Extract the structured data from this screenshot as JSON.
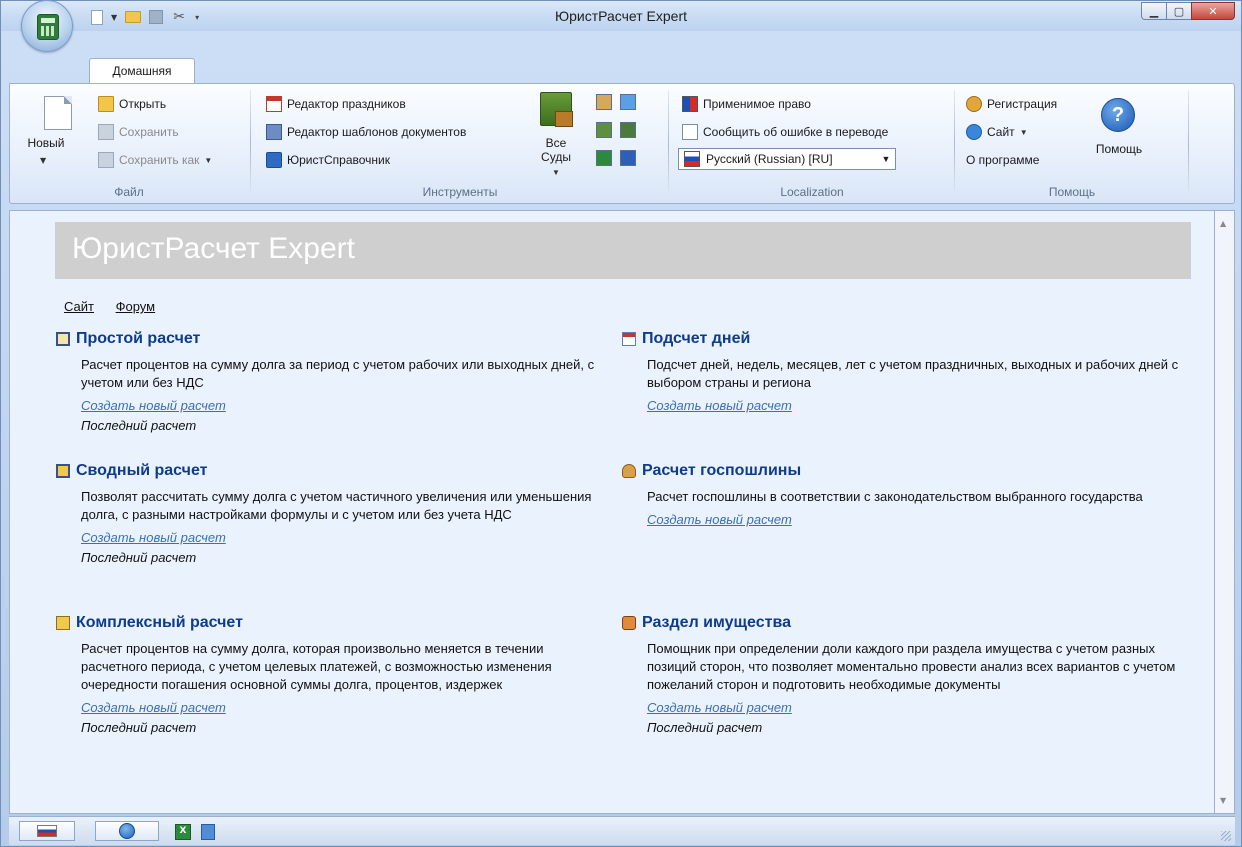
{
  "window": {
    "title": "ЮристРасчет Expert",
    "minimize_symbol": "▁",
    "maximize_symbol": "▢",
    "close_symbol": "✕"
  },
  "tabs": {
    "home": "Домашняя"
  },
  "ribbon": {
    "file": {
      "label": "Файл",
      "new": "Новый",
      "open": "Открыть",
      "save": "Сохранить",
      "save_as": "Сохранить как"
    },
    "tools": {
      "label": "Инструменты",
      "holidays_editor": "Редактор праздников",
      "templates_editor": "Редактор шаблонов документов",
      "reference": "ЮристСправочник",
      "all_courts_line1": "Все",
      "all_courts_line2": "Суды"
    },
    "localization": {
      "label": "Localization",
      "applicable_law": "Применимое право",
      "report_error": "Сообщить об ошибке в переводе",
      "language_selected": "Русский (Russian) [RU]"
    },
    "help": {
      "label": "Помощь",
      "registration": "Регистрация",
      "site": "Сайт",
      "about": "О программе",
      "help_button": "Помощь",
      "help_symbol": "?"
    }
  },
  "content": {
    "banner_title": "ЮристРасчет Expert",
    "links": {
      "site": "Сайт",
      "forum": "Форум"
    },
    "sections": [
      {
        "title": "Простой расчет",
        "description": "Расчет процентов на сумму долга за период с учетом рабочих или выходных дней, с учетом или без НДС",
        "create_link": "Создать новый расчет",
        "last_label": "Последний расчет"
      },
      {
        "title": "Подсчет дней",
        "description": "Подсчет дней, недель, месяцев, лет с учетом праздничных, выходных и рабочих дней с выбором страны и региона",
        "create_link": "Создать новый расчет"
      },
      {
        "title": "Сводный расчет",
        "description": "Позволят рассчитать сумму долга с учетом частичного увеличения или уменьшения долга, с разными настройками формулы и с учетом или без учета НДС",
        "create_link": "Создать новый расчет",
        "last_label": "Последний расчет"
      },
      {
        "title": "Расчет госпошлины",
        "description": "Расчет госпошлины в соответствии с законодательством выбранного государства",
        "create_link": "Создать новый расчет"
      },
      {
        "title": "Комплексный расчет",
        "description": "Расчет процентов на сумму долга, которая произвольно меняется в течении расчетного периода, с учетом целевых платежей, с возможностью изменения очередности погашения основной суммы долга, процентов, издержек",
        "create_link": "Создать новый расчет",
        "last_label": "Последний расчет"
      },
      {
        "title": "Раздел имущества",
        "description": "Помощник при определении доли каждого при раздела имущества с учетом разных позиций сторон, что позволяет моментально провести анализ всех вариантов с учетом пожеланий сторон и подготовить необходимые документы",
        "create_link": "Создать новый расчет",
        "last_label": "Последний расчет"
      }
    ]
  },
  "statusbar": {
    "excel_letter": "X"
  }
}
